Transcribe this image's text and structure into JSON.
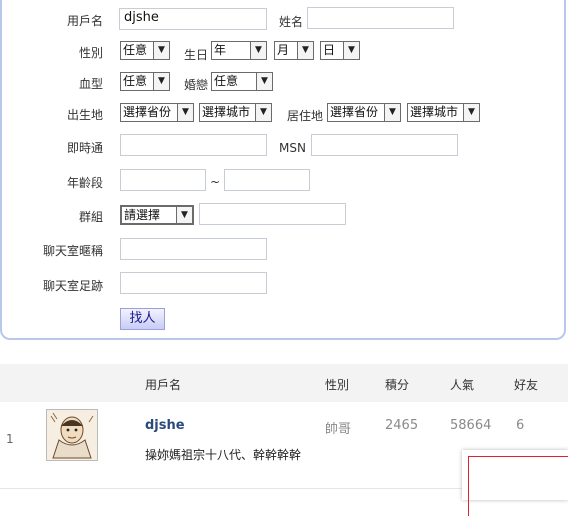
{
  "form": {
    "username_label": "用戶名",
    "username_value": "djshe",
    "name_label": "姓名",
    "name_value": "",
    "gender_label": "性別",
    "gender_value": "任意",
    "birthday_label": "生日",
    "birth_year": "年",
    "birth_month": "月",
    "birth_day": "日",
    "blood_label": "血型",
    "blood_value": "任意",
    "marital_label": "婚戀",
    "marital_value": "任意",
    "birthplace_label": "出生地",
    "birth_province": "選擇省份",
    "birth_city": "選擇城市",
    "residence_label": "居住地",
    "res_province": "選擇省份",
    "res_city": "選擇城市",
    "im_label": "即時通",
    "msn_label": "MSN",
    "age_label": "年齡段",
    "age_sep": "~",
    "group_label": "群組",
    "group_value": "請選擇",
    "chat_nick_label": "聊天室暱稱",
    "chat_trace_label": "聊天室足跡",
    "search_button": "找人"
  },
  "results": {
    "headers": {
      "username": "用戶名",
      "gender": "性別",
      "points": "積分",
      "popularity": "人氣",
      "friends": "好友"
    },
    "rows": [
      {
        "index": "1",
        "username": "djshe",
        "gender": "帥哥",
        "points": "2465",
        "popularity": "58664",
        "friends": "6",
        "signature": "操妳媽祖宗十八代、幹幹幹幹"
      }
    ]
  }
}
